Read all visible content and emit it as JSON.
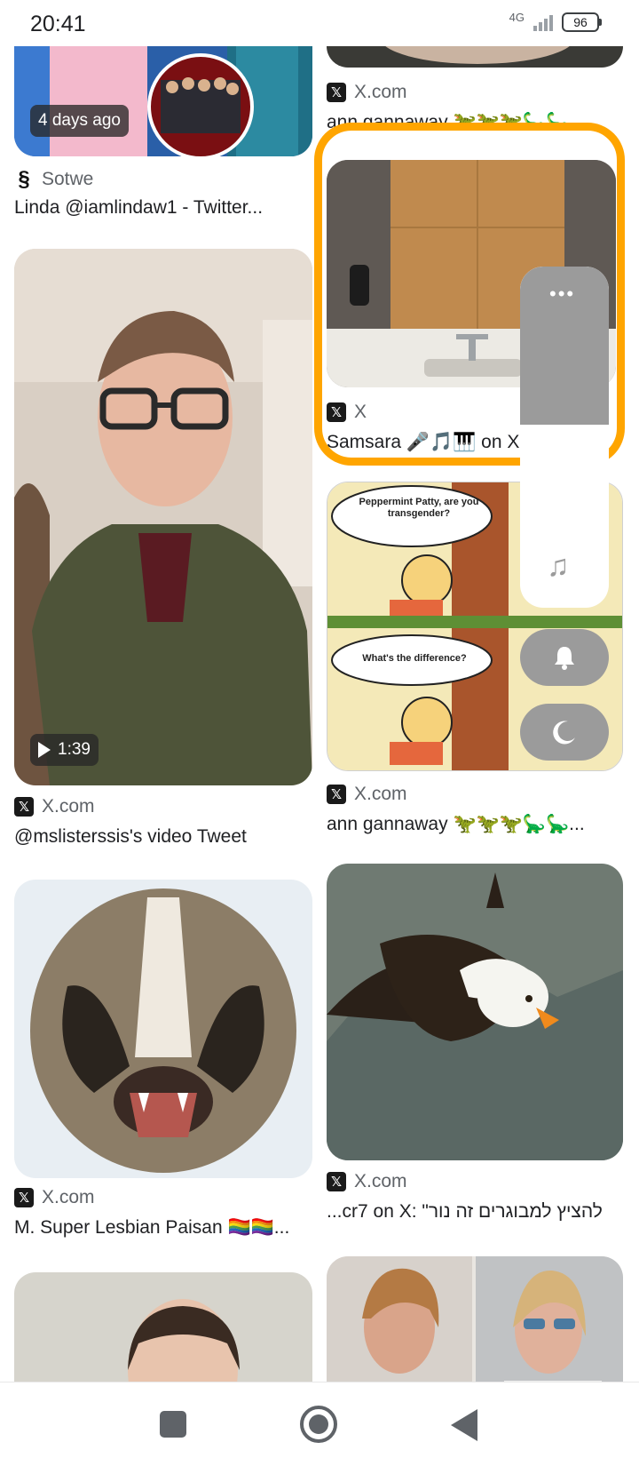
{
  "status_bar": {
    "time": "20:41",
    "network": "4G",
    "battery": "96"
  },
  "cards": [
    {
      "source": "Sotwe",
      "title": "Linda @iamlindaw1 - Twitter...",
      "badge": "4 days ago"
    },
    {
      "source": "X.com",
      "title": "@mslisterssis's video Tweet",
      "badge": "1:39"
    },
    {
      "source": "X.com",
      "title": "M. Super Lesbian Paisan 🏳️‍🌈🏳️‍🌈..."
    },
    {
      "source": "X.com",
      "title": "ann gannaway 🦖🦖🦖🦕🦕..."
    },
    {
      "source": "X",
      "title": "Samsara 🎤🎵🎹 on X"
    },
    {
      "source": "X.com",
      "title": "ann gannaway 🦖🦖🦖🦕🦕..."
    },
    {
      "source": "X.com",
      "title": "...cr7 on X: \"להציץ למבוגרים זה נור"
    }
  ],
  "comic": {
    "panel1": "Peppermint Patty, are you transgender?",
    "panel2": "What's the difference?"
  },
  "side_panel": {
    "more_icon": "more-horizontal-icon",
    "music_icon": "music-note-icon",
    "bell_icon": "bell-icon",
    "moon_icon": "moon-icon"
  },
  "colors": {
    "highlight": "#ffa500",
    "panel_gray": "#9b9b9b"
  }
}
